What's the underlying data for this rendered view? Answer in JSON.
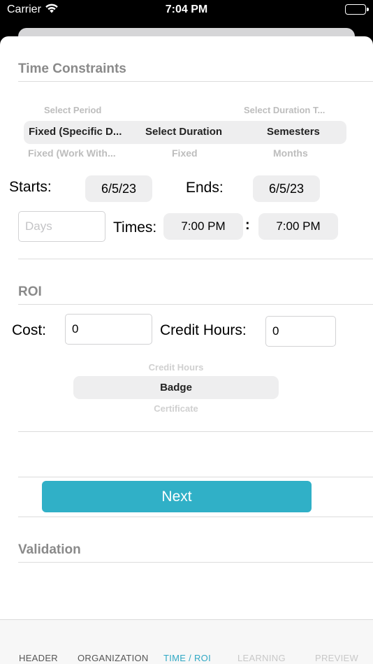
{
  "status": {
    "carrier": "Carrier",
    "time": "7:04 PM"
  },
  "time_constraints": {
    "title": "Time Constraints",
    "period_picker": {
      "above": "Select Period",
      "selected": "Fixed (Specific D...",
      "below": "Fixed (Work With..."
    },
    "duration_picker": {
      "above": "",
      "selected": "Select Duration",
      "below": "Fixed"
    },
    "unit_picker": {
      "above": "Select Duration T...",
      "selected": "Semesters",
      "below": "Months"
    },
    "starts_label": "Starts:",
    "starts_value": "6/5/23",
    "ends_label": "Ends:",
    "ends_value": "6/5/23",
    "days_placeholder": "Days",
    "times_label": "Times:",
    "time_start": "7:00 PM",
    "time_separator": ":",
    "time_end": "7:00 PM"
  },
  "roi": {
    "title": "ROI",
    "cost_label": "Cost:",
    "cost_value": "0",
    "credit_hours_label": "Credit Hours:",
    "credit_hours_value": "0",
    "type_picker": {
      "above": "Credit Hours",
      "selected": "Badge",
      "below": "Certificate"
    }
  },
  "next_label": "Next",
  "validation": {
    "title": "Validation"
  },
  "tabs": [
    {
      "label": "HEADER",
      "state": "normal"
    },
    {
      "label": "ORGANIZATION",
      "state": "normal"
    },
    {
      "label": "TIME / ROI",
      "state": "active"
    },
    {
      "label": "LEARNING",
      "state": "disabled"
    },
    {
      "label": "PREVIEW",
      "state": "disabled"
    }
  ],
  "colors": {
    "accent": "#30b0c7",
    "tab_normal": "#555555",
    "tab_active": "#30a8c4",
    "tab_disabled": "#c8c8c8"
  }
}
